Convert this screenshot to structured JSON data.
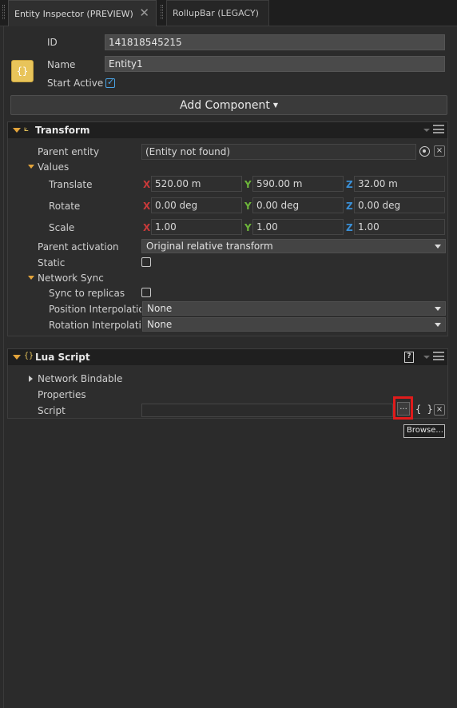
{
  "tabs": [
    {
      "label": "Entity Inspector (PREVIEW)",
      "close": "✕"
    },
    {
      "label": "RollupBar (LEGACY)"
    }
  ],
  "entity": {
    "icon_text": "{}",
    "id_label": "ID",
    "id_value": "141818545215",
    "name_label": "Name",
    "name_value": "Entity1",
    "start_active_label": "Start Active",
    "start_active": true
  },
  "add_component": {
    "label": "Add Component"
  },
  "transform": {
    "title": "Transform",
    "parent_entity_label": "Parent entity",
    "parent_entity_value": "(Entity not found)",
    "clear": "×",
    "values_label": "Values",
    "translate_label": "Translate",
    "translate": {
      "x": "520.00 m",
      "y": "590.00 m",
      "z": "32.00 m"
    },
    "rotate_label": "Rotate",
    "rotate": {
      "x": "0.00 deg",
      "y": "0.00 deg",
      "z": "0.00 deg"
    },
    "scale_label": "Scale",
    "scale": {
      "x": "1.00",
      "y": "1.00",
      "z": "1.00"
    },
    "axis": {
      "x": "X",
      "y": "Y",
      "z": "Z"
    },
    "parent_activation_label": "Parent activation",
    "parent_activation_value": "Original relative transform",
    "static_label": "Static",
    "network_sync_label": "Network Sync",
    "sync_to_replicas_label": "Sync to replicas",
    "position_interp_label": "Position Interpolation",
    "position_interp_value": "None",
    "rotation_interp_label": "Rotation Interpolation",
    "rotation_interp_value": "None"
  },
  "lua_script": {
    "title": "Lua Script",
    "help": "?",
    "network_bindable_label": "Network Bindable",
    "properties_label": "Properties",
    "script_label": "Script",
    "script_value": "",
    "browse_button": "...",
    "braces": "{ }",
    "clear": "×",
    "tooltip": "Browse..."
  },
  "colors": {
    "background": "#2b2b2b",
    "accent_orange": "#e3a43b",
    "axis_x": "#c93a3a",
    "axis_y": "#6db53a",
    "axis_z": "#3a8fd6",
    "highlight": "#e01b1b"
  }
}
